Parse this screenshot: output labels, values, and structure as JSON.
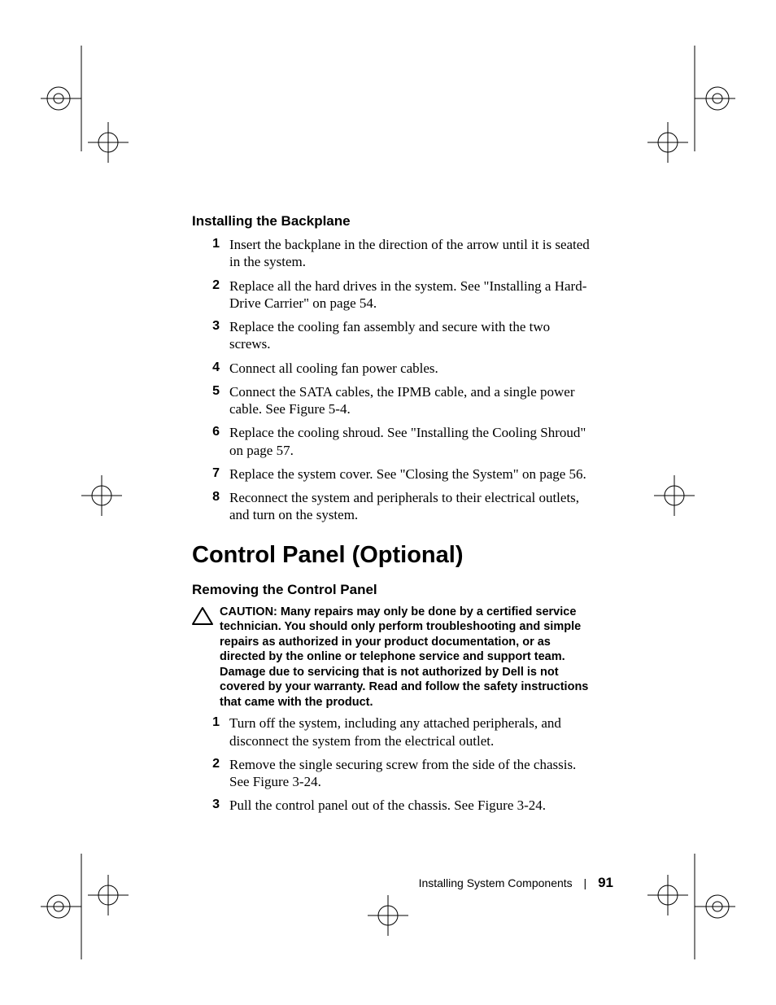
{
  "section1": {
    "heading": "Installing the Backplane",
    "steps": [
      "Insert the backplane in the direction of the arrow until it is seated in the system.",
      "Replace all the hard drives in the system. See \"Installing a Hard-Drive Carrier\" on page 54.",
      "Replace the cooling fan assembly and secure with the two screws.",
      "Connect all cooling fan power cables.",
      "Connect the SATA cables, the IPMB cable, and a single power cable. See Figure 5-4.",
      "Replace the cooling shroud. See \"Installing the Cooling Shroud\" on page 57.",
      "Replace the system cover. See \"Closing the System\" on page 56.",
      "Reconnect the system and peripherals to their electrical outlets, and turn on the system."
    ]
  },
  "section2": {
    "title": "Control Panel (Optional)",
    "heading": "Removing the Control Panel",
    "caution_label": "CAUTION: ",
    "caution_text": "Many repairs may only be done by a certified service technician. You should only perform troubleshooting and simple repairs as authorized in your product documentation, or as directed by the online or telephone service and support team. Damage due to servicing that is not authorized by Dell is not covered by your warranty. Read and follow the safety instructions that came with the product.",
    "steps": [
      "Turn off the system, including any attached peripherals, and disconnect the system from the electrical outlet.",
      "Remove the single securing screw from the side of the chassis. See Figure 3-24.",
      "Pull the control panel out of the chassis. See Figure 3-24."
    ]
  },
  "footer": {
    "chapter": "Installing System Components",
    "divider": "|",
    "page": "91"
  },
  "numbers": [
    "1",
    "2",
    "3",
    "4",
    "5",
    "6",
    "7",
    "8"
  ]
}
